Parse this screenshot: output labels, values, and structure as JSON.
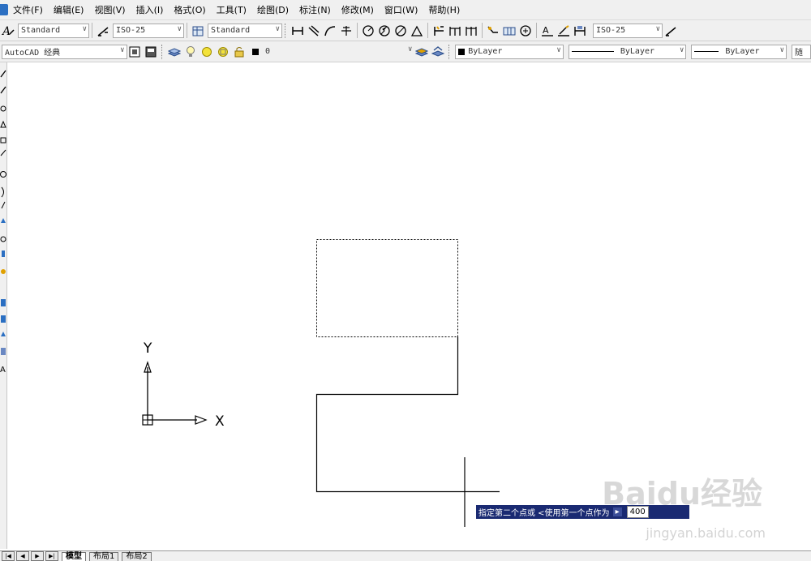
{
  "menu": [
    "文件(F)",
    "编辑(E)",
    "视图(V)",
    "插入(I)",
    "格式(O)",
    "工具(T)",
    "绘图(D)",
    "标注(N)",
    "修改(M)",
    "窗口(W)",
    "帮助(H)"
  ],
  "toolbar1": {
    "text_style": "Standard",
    "dim_style": "ISO-25",
    "table_style": "Standard",
    "dim_style_2": "ISO-25"
  },
  "toolbar2": {
    "workspace": "AutoCAD 经典",
    "layer": "0",
    "color": "ByLayer",
    "linetype": "ByLayer",
    "lineweight": "ByLayer",
    "plotstyle": "随"
  },
  "ucs": {
    "x_label": "X",
    "y_label": "Y"
  },
  "command_prompt": {
    "text": "指定第二个点或 <使用第一个点作为",
    "value": "400"
  },
  "tabs": [
    "模型",
    "布局1",
    "布局2"
  ],
  "watermark": {
    "brand": "Baidu经验",
    "url": "jingyan.baidu.com"
  },
  "icons": {
    "text_style": "text-style-icon",
    "dim_style": "dim-style-icon",
    "layer_manager": "layer-manager-icon"
  }
}
